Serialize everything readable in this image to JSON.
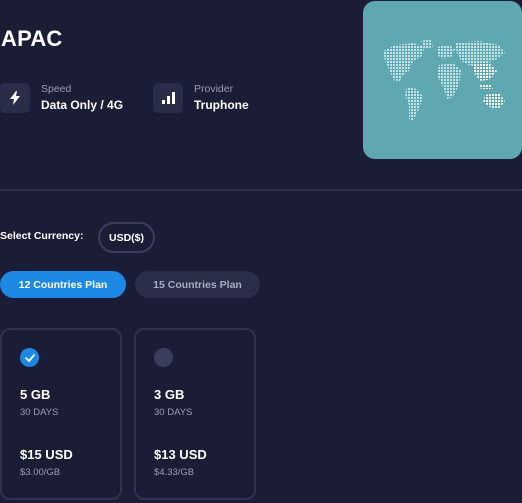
{
  "region": {
    "title": "APAC"
  },
  "specs": {
    "speed": {
      "label": "Speed",
      "value": "Data Only / 4G",
      "icon": "lightning-icon"
    },
    "provider": {
      "label": "Provider",
      "value": "Truphone",
      "icon": "signal-bars-icon"
    }
  },
  "map": {
    "icon": "world-map-icon",
    "background": "#5fa8b2",
    "highlight": "APAC"
  },
  "currency": {
    "label": "Select Currency:",
    "selected": "USD($)"
  },
  "tabs": [
    {
      "label": "12 Countries Plan",
      "active": true
    },
    {
      "label": "15 Countries Plan",
      "active": false
    }
  ],
  "plans": [
    {
      "data": "5 GB",
      "validity": "30 DAYS",
      "price": "$15 USD",
      "per_gb": "$3.00/GB",
      "selected": true
    },
    {
      "data": "3 GB",
      "validity": "30 DAYS",
      "price": "$13 USD",
      "per_gb": "$4.33/GB",
      "selected": false
    }
  ],
  "colors": {
    "background": "#1b1d36",
    "accent": "#1e88e5",
    "card_border": "#2f3250",
    "muted_text": "#9a9db3"
  }
}
